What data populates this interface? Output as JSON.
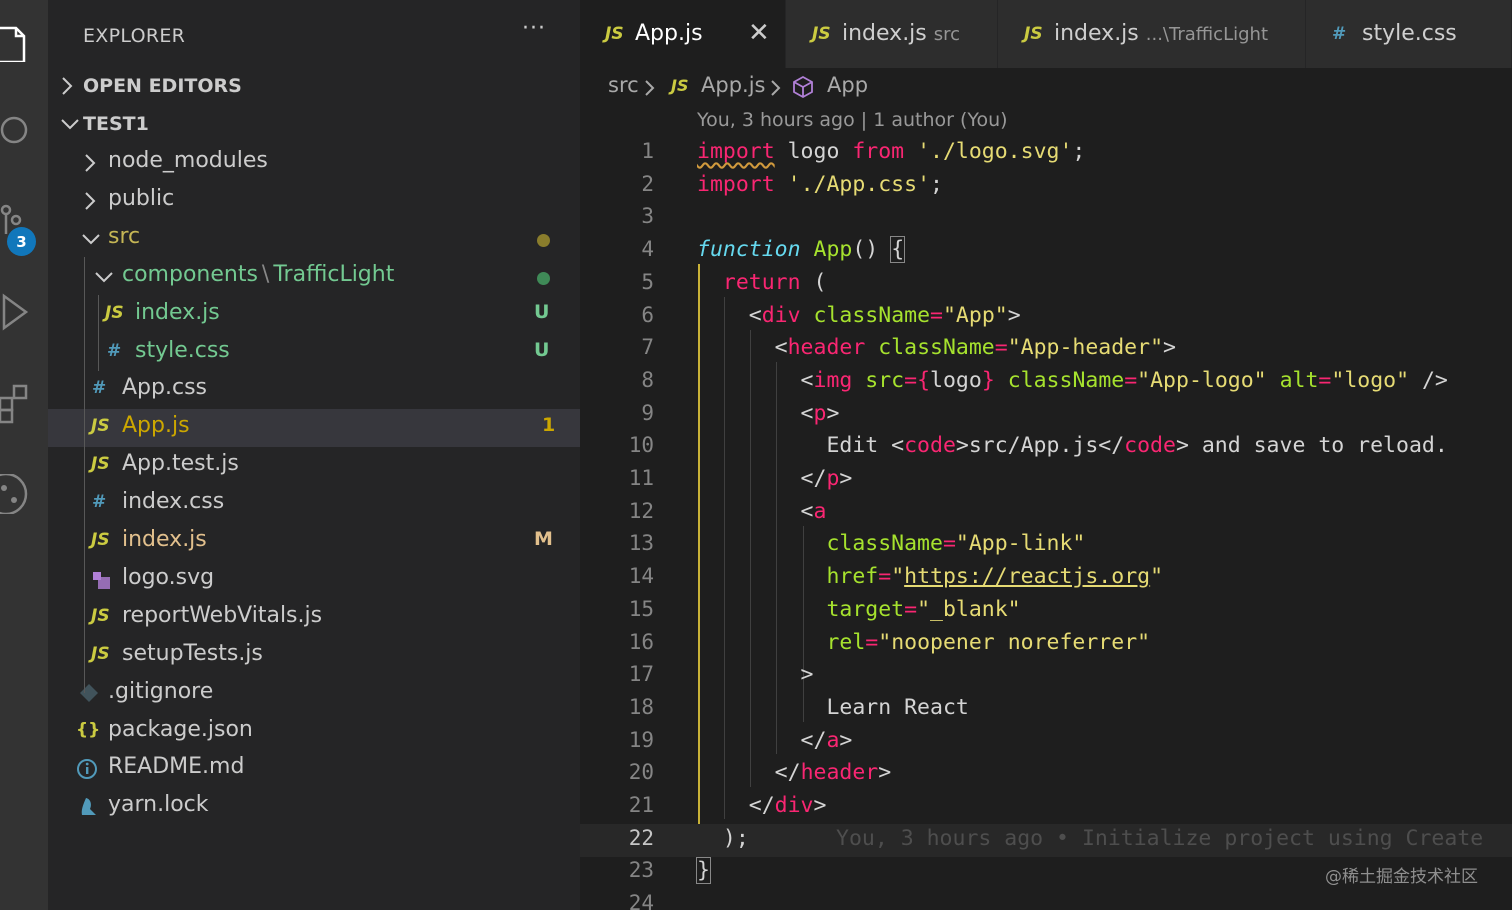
{
  "activity": {
    "badge": "3"
  },
  "sidebar": {
    "title": "EXPLORER",
    "more": "···",
    "sections": [
      {
        "label": "OPEN EDITORS",
        "expanded": false
      },
      {
        "label": "TEST1",
        "expanded": true
      }
    ],
    "tree": [
      {
        "name": "node_modules",
        "type": "folder",
        "expanded": false,
        "color": "#cccccc"
      },
      {
        "name": "public",
        "type": "folder",
        "expanded": false,
        "color": "#cccccc"
      },
      {
        "name": "src",
        "type": "folder",
        "expanded": true,
        "color": "#c5b655",
        "dot": "#8a7d2c"
      },
      {
        "name": "components",
        "sep": "\\",
        "name2": "TrafficLight",
        "type": "folder",
        "expanded": true,
        "color": "#73c991",
        "dot": "#3f8a57"
      },
      {
        "name": "index.js",
        "icon": "JS",
        "color": "#73c991",
        "status": "U"
      },
      {
        "name": "style.css",
        "icon": "#",
        "color": "#73c991",
        "status": "U"
      },
      {
        "name": "App.css",
        "icon": "#",
        "color": "#cccccc"
      },
      {
        "name": "App.js",
        "icon": "JS",
        "color": "#cca700",
        "status": "1",
        "selected": true
      },
      {
        "name": "App.test.js",
        "icon": "JS",
        "color": "#cccccc"
      },
      {
        "name": "index.css",
        "icon": "#",
        "color": "#cccccc"
      },
      {
        "name": "index.js",
        "icon": "JS",
        "color": "#e2c08d",
        "status": "M"
      },
      {
        "name": "logo.svg",
        "icon": "svg",
        "color": "#cccccc"
      },
      {
        "name": "reportWebVitals.js",
        "icon": "JS",
        "color": "#cccccc"
      },
      {
        "name": "setupTests.js",
        "icon": "JS",
        "color": "#cccccc"
      },
      {
        "name": ".gitignore",
        "icon": "git",
        "color": "#cccccc"
      },
      {
        "name": "package.json",
        "icon": "{}",
        "color": "#cccccc"
      },
      {
        "name": "README.md",
        "icon": "i",
        "color": "#cccccc"
      },
      {
        "name": "yarn.lock",
        "icon": "yarn",
        "color": "#cccccc"
      }
    ]
  },
  "tabs": [
    {
      "label": "App.js",
      "icon": "JS",
      "desc": "",
      "active": true,
      "close": "✕"
    },
    {
      "label": "index.js",
      "icon": "JS",
      "desc": "src"
    },
    {
      "label": "index.js",
      "icon": "JS",
      "desc": "...\\TrafficLight"
    },
    {
      "label": "style.css",
      "icon": "#",
      "desc": ""
    }
  ],
  "breadcrumbs": {
    "folder": "src",
    "file": "App.js",
    "symbol": "App"
  },
  "editor": {
    "codelens": "You, 3 hours ago | 1 author (You)",
    "blame": "You, 3 hours ago • Initialize project using Create",
    "line_numbers": [
      "1",
      "2",
      "3",
      "4",
      "5",
      "6",
      "7",
      "8",
      "9",
      "10",
      "11",
      "12",
      "13",
      "14",
      "15",
      "16",
      "17",
      "18",
      "19",
      "20",
      "21",
      "22",
      "23",
      "24"
    ],
    "current_line": 22
  },
  "colors": {
    "keyword": "#f92672",
    "function": "#66d9ef",
    "name": "#a6e22e",
    "string": "#e6db74",
    "status_modified": "#e2c08d",
    "status_untracked": "#73c991",
    "status_error": "#cca700"
  },
  "watermark": "@稀土掘金技术社区"
}
